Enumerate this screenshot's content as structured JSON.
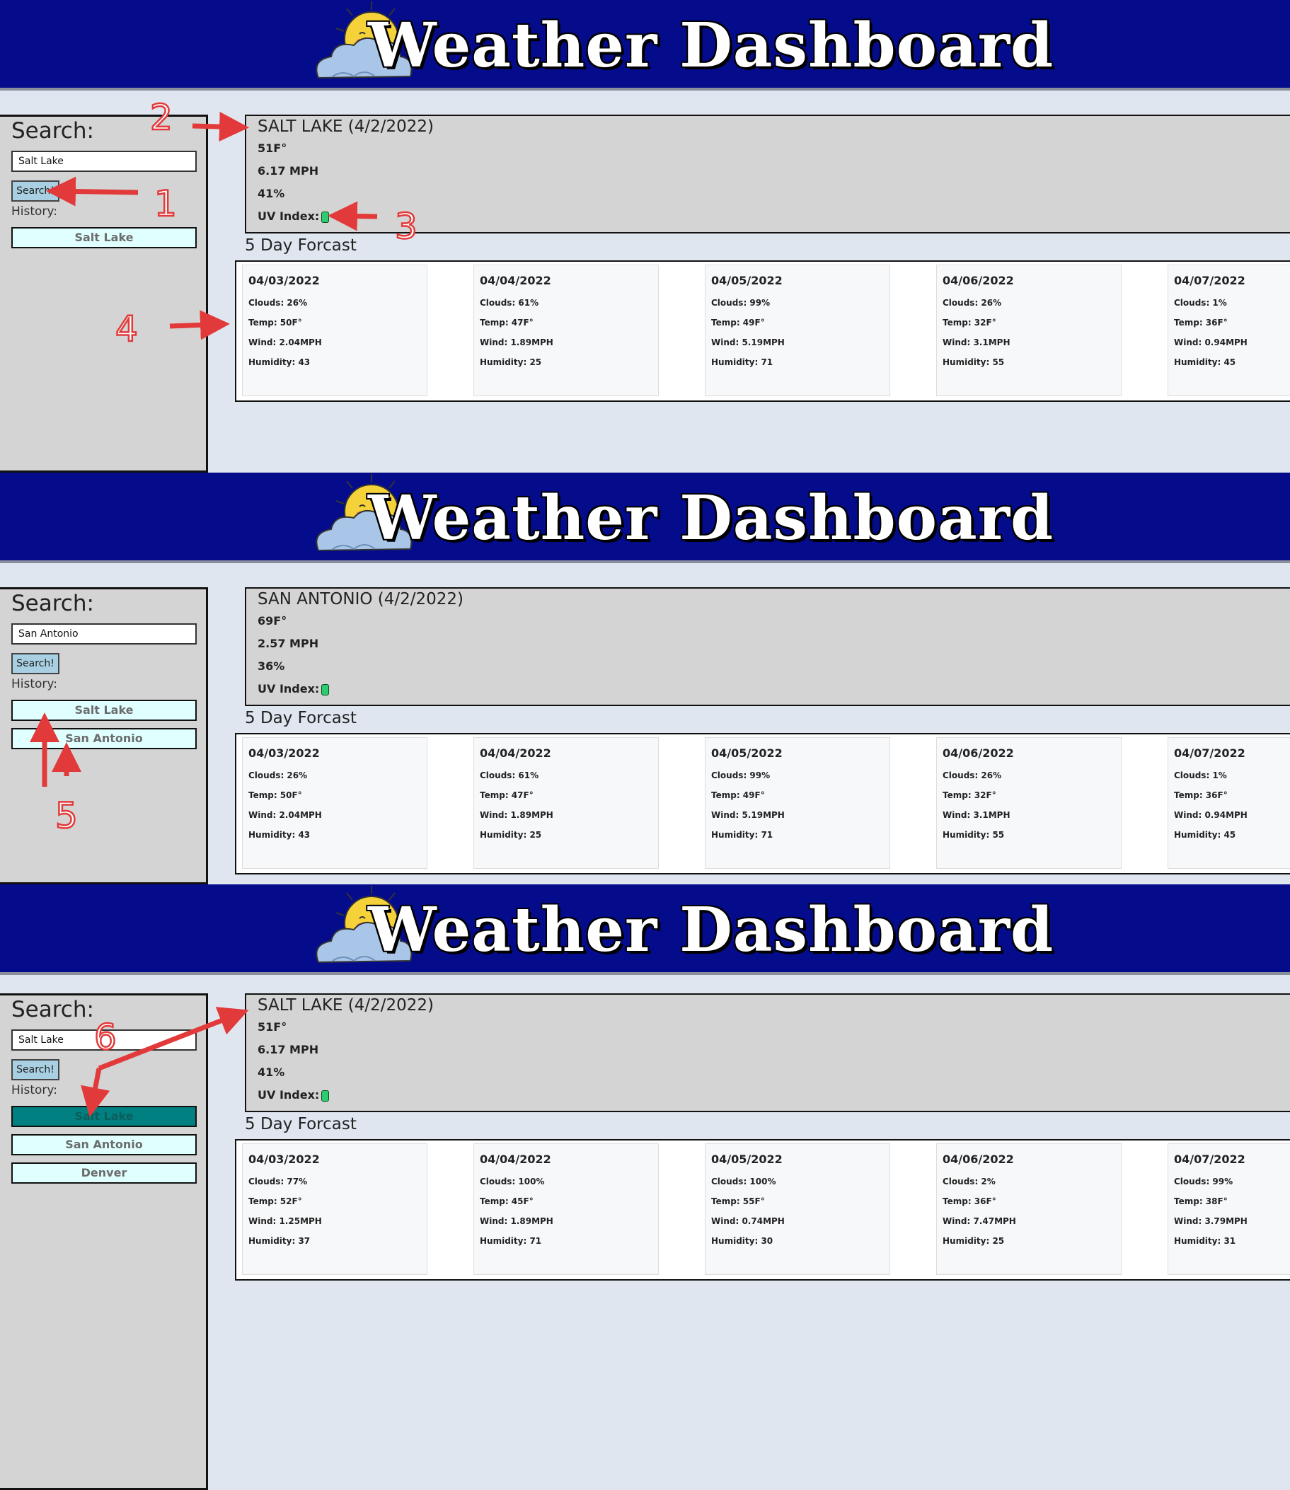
{
  "header": {
    "title": "Weather Dashboard",
    "logo_icon": "sun-cloud-icon"
  },
  "panels": [
    {
      "search_label": "Search:",
      "search_value": "Salt Lake",
      "search_button": "Search!",
      "history_label": "History:",
      "history": [
        "Salt Lake"
      ],
      "active_history": -1,
      "current": {
        "city": "SALT LAKE (4/2/2022)",
        "temp": "51F°",
        "wind": "6.17 MPH",
        "humidity": "41%",
        "uv_label": "UV Index:",
        "uv_value": "0"
      },
      "forecast_label": "5 Day Forcast",
      "forecast": [
        {
          "date": "04/03/2022",
          "clouds": "Clouds: 26%",
          "temp": "Temp: 50F°",
          "wind": "Wind: 2.04MPH",
          "humidity": "Humidity: 43"
        },
        {
          "date": "04/04/2022",
          "clouds": "Clouds: 61%",
          "temp": "Temp: 47F°",
          "wind": "Wind: 1.89MPH",
          "humidity": "Humidity: 25"
        },
        {
          "date": "04/05/2022",
          "clouds": "Clouds: 99%",
          "temp": "Temp: 49F°",
          "wind": "Wind: 5.19MPH",
          "humidity": "Humidity: 71"
        },
        {
          "date": "04/06/2022",
          "clouds": "Clouds: 26%",
          "temp": "Temp: 32F°",
          "wind": "Wind: 3.1MPH",
          "humidity": "Humidity: 55"
        },
        {
          "date": "04/07/2022",
          "clouds": "Clouds: 1%",
          "temp": "Temp: 36F°",
          "wind": "Wind: 0.94MPH",
          "humidity": "Humidity: 45"
        }
      ]
    },
    {
      "search_label": "Search:",
      "search_value": "San Antonio",
      "search_button": "Search!",
      "history_label": "History:",
      "history": [
        "Salt Lake",
        "San Antonio"
      ],
      "active_history": -1,
      "current": {
        "city": "SAN ANTONIO (4/2/2022)",
        "temp": "69F°",
        "wind": "2.57 MPH",
        "humidity": "36%",
        "uv_label": "UV Index:",
        "uv_value": "0"
      },
      "forecast_label": "5 Day Forcast",
      "forecast": [
        {
          "date": "04/03/2022",
          "clouds": "Clouds: 26%",
          "temp": "Temp: 50F°",
          "wind": "Wind: 2.04MPH",
          "humidity": "Humidity: 43"
        },
        {
          "date": "04/04/2022",
          "clouds": "Clouds: 61%",
          "temp": "Temp: 47F°",
          "wind": "Wind: 1.89MPH",
          "humidity": "Humidity: 25"
        },
        {
          "date": "04/05/2022",
          "clouds": "Clouds: 99%",
          "temp": "Temp: 49F°",
          "wind": "Wind: 5.19MPH",
          "humidity": "Humidity: 71"
        },
        {
          "date": "04/06/2022",
          "clouds": "Clouds: 26%",
          "temp": "Temp: 32F°",
          "wind": "Wind: 3.1MPH",
          "humidity": "Humidity: 55"
        },
        {
          "date": "04/07/2022",
          "clouds": "Clouds: 1%",
          "temp": "Temp: 36F°",
          "wind": "Wind: 0.94MPH",
          "humidity": "Humidity: 45"
        }
      ]
    },
    {
      "search_label": "Search:",
      "search_value": "Salt Lake",
      "search_button": "Search!",
      "history_label": "History:",
      "history": [
        "Salt Lake",
        "San Antonio",
        "Denver"
      ],
      "active_history": 0,
      "current": {
        "city": "SALT LAKE (4/2/2022)",
        "temp": "51F°",
        "wind": "6.17 MPH",
        "humidity": "41%",
        "uv_label": "UV Index:",
        "uv_value": "0"
      },
      "forecast_label": "5 Day Forcast",
      "forecast": [
        {
          "date": "04/03/2022",
          "clouds": "Clouds: 77%",
          "temp": "Temp: 52F°",
          "wind": "Wind: 1.25MPH",
          "humidity": "Humidity: 37"
        },
        {
          "date": "04/04/2022",
          "clouds": "Clouds: 100%",
          "temp": "Temp: 45F°",
          "wind": "Wind: 1.89MPH",
          "humidity": "Humidity: 71"
        },
        {
          "date": "04/05/2022",
          "clouds": "Clouds: 100%",
          "temp": "Temp: 55F°",
          "wind": "Wind: 0.74MPH",
          "humidity": "Humidity: 30"
        },
        {
          "date": "04/06/2022",
          "clouds": "Clouds: 2%",
          "temp": "Temp: 36F°",
          "wind": "Wind: 7.47MPH",
          "humidity": "Humidity: 25"
        },
        {
          "date": "04/07/2022",
          "clouds": "Clouds: 99%",
          "temp": "Temp: 38F°",
          "wind": "Wind: 3.79MPH",
          "humidity": "Humidity: 31"
        }
      ]
    }
  ],
  "annotations": [
    "1",
    "2",
    "3",
    "4",
    "5",
    "6"
  ],
  "colors": {
    "header_bg": "#050c8c",
    "history_bg": "#e0ffff",
    "active_history_bg": "#008080",
    "annotation": "#e23a3a",
    "uv_green": "#2ecc71"
  }
}
